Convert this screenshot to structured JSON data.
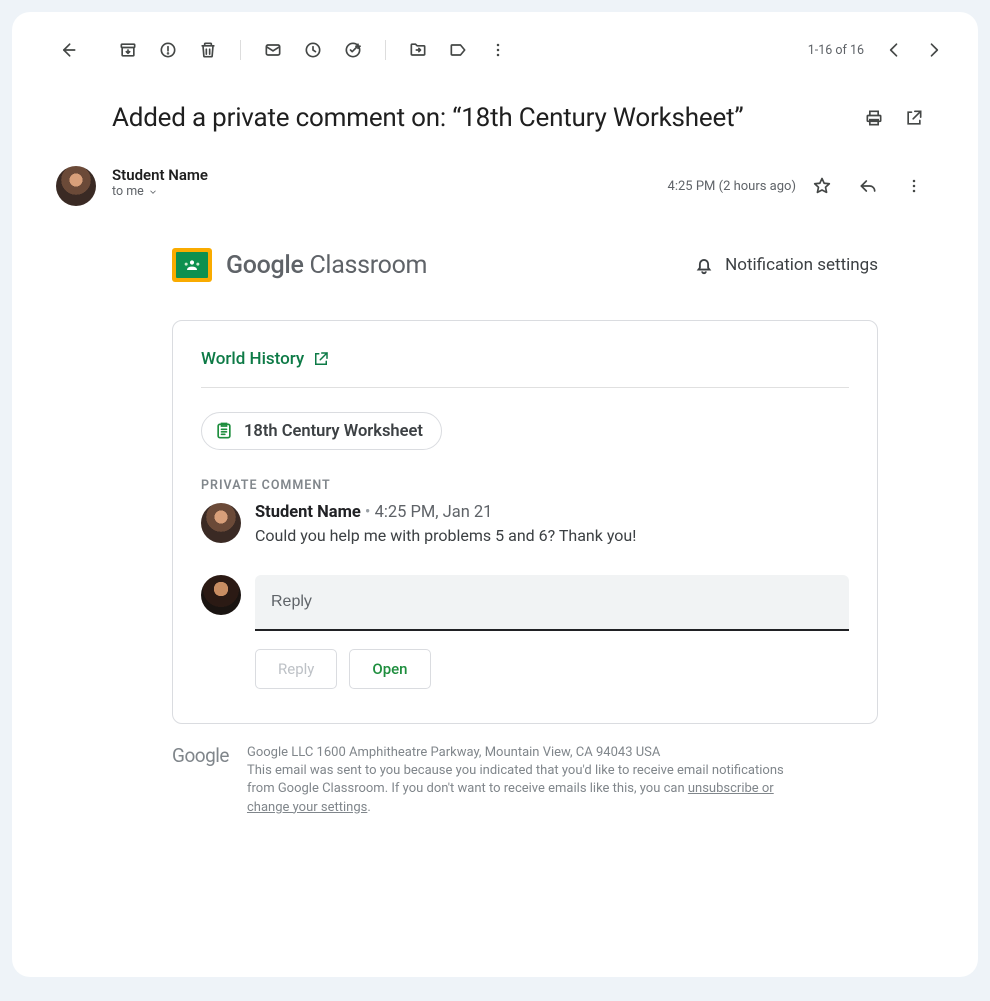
{
  "toolbar": {
    "pager": "1-16 of 16"
  },
  "subject": "Added a private comment on: “18th Century Worksheet”",
  "message": {
    "sender": "Student Name",
    "recipient_line": "to me",
    "timestamp": "4:25 PM (2 hours ago)"
  },
  "classroom": {
    "brand_bold": "Google",
    "brand_light": " Classroom",
    "notification_label": "Notification settings",
    "class_name": "World History",
    "assignment_chip": "18th Century Worksheet",
    "section_label": "PRIVATE COMMENT",
    "comment": {
      "author": "Student Name",
      "dot": " • ",
      "time": "4:25 PM, Jan 21",
      "text": "Could you help me with problems 5 and 6? Thank you!"
    },
    "reply_placeholder": "Reply",
    "reply_button": "Reply",
    "open_button": "Open"
  },
  "footer": {
    "logo": "Google",
    "line1": "Google LLC 1600 Amphitheatre Parkway, Mountain View, CA 94043 USA",
    "line2a": "This email was sent to you because you indicated that you'd like to receive email notifications from Google Classroom. If you don't want to receive emails like this, you can ",
    "unsub": "unsubscribe or change your settings",
    "line2b": "."
  }
}
